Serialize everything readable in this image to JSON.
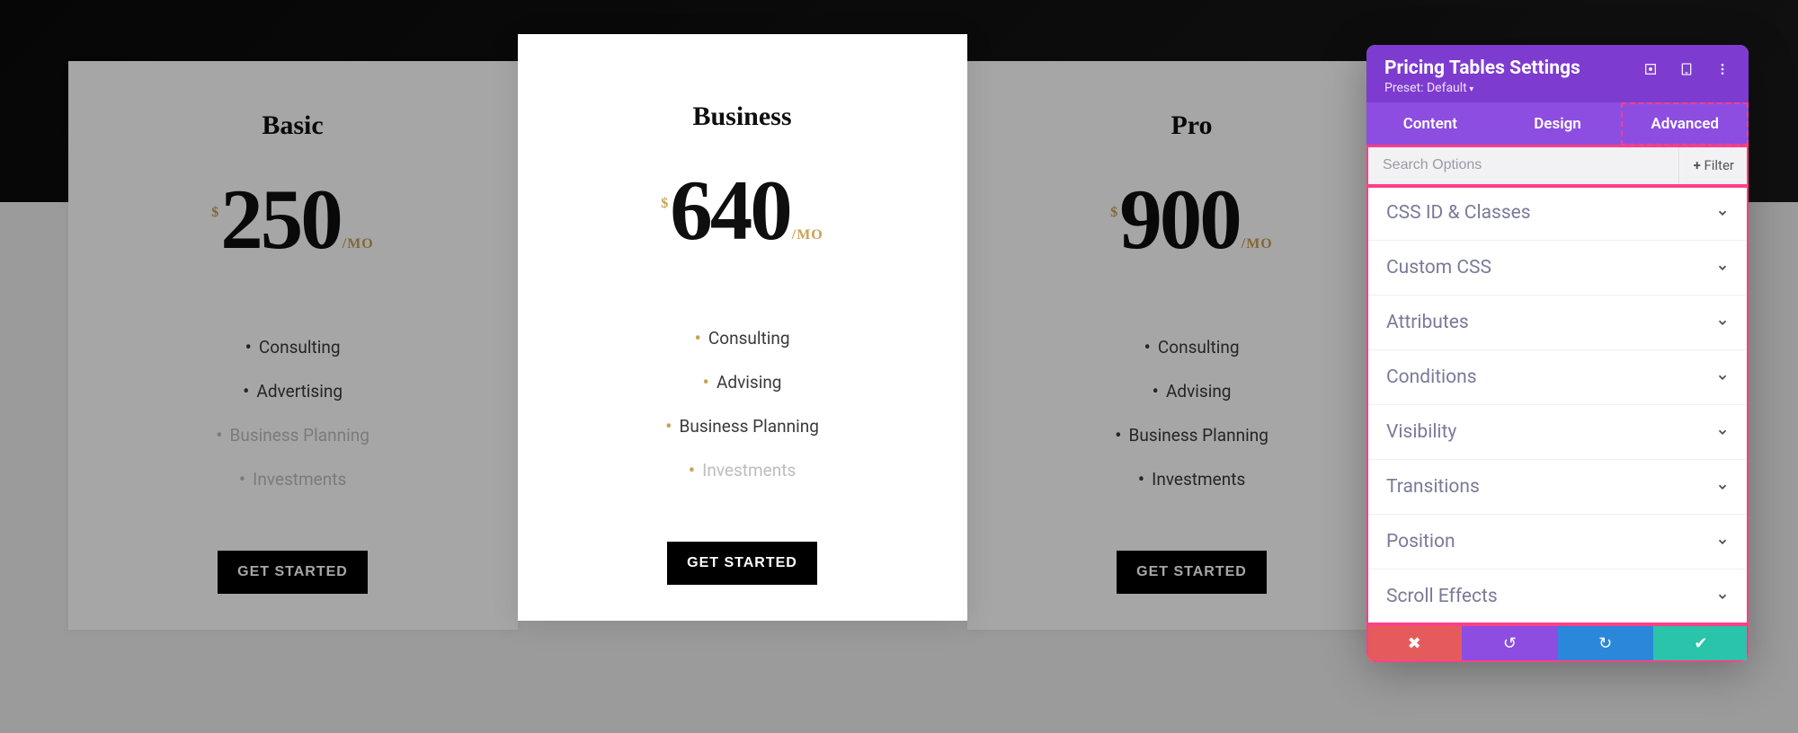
{
  "pricing": {
    "cards": [
      {
        "title": "Basic",
        "currency": "$",
        "price": "250",
        "period": "/MO",
        "cta": "GET STARTED",
        "features": [
          {
            "text": "Consulting",
            "dim": false
          },
          {
            "text": "Advertising",
            "dim": false
          },
          {
            "text": "Business Planning",
            "dim": true
          },
          {
            "text": "Investments",
            "dim": true
          }
        ]
      },
      {
        "title": "Business",
        "currency": "$",
        "price": "640",
        "period": "/MO",
        "cta": "GET STARTED",
        "featured": true,
        "features": [
          {
            "text": "Consulting",
            "dim": false
          },
          {
            "text": "Advising",
            "dim": false
          },
          {
            "text": "Business Planning",
            "dim": false
          },
          {
            "text": "Investments",
            "dim": true
          }
        ]
      },
      {
        "title": "Pro",
        "currency": "$",
        "price": "900",
        "period": "/MO",
        "cta": "GET STARTED",
        "features": [
          {
            "text": "Consulting",
            "dim": false
          },
          {
            "text": "Advising",
            "dim": false
          },
          {
            "text": "Business Planning",
            "dim": false
          },
          {
            "text": "Investments",
            "dim": false
          }
        ]
      }
    ]
  },
  "panel": {
    "title": "Pricing Tables Settings",
    "preset": "Preset: Default",
    "tabs": [
      {
        "label": "Content",
        "active": false
      },
      {
        "label": "Design",
        "active": false
      },
      {
        "label": "Advanced",
        "active": true
      }
    ],
    "search_placeholder": "Search Options",
    "filter_label": "Filter",
    "sections": [
      "CSS ID & Classes",
      "Custom CSS",
      "Attributes",
      "Conditions",
      "Visibility",
      "Transitions",
      "Position",
      "Scroll Effects"
    ]
  }
}
